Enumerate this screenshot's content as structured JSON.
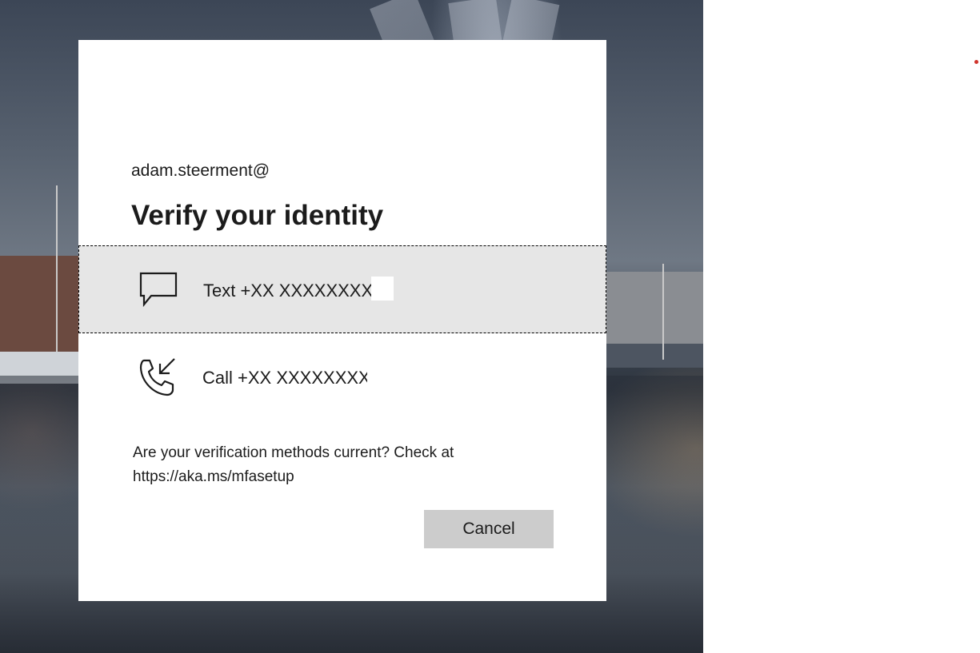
{
  "dialog": {
    "account": "adam.steerment@",
    "title": "Verify your identity",
    "options": [
      {
        "icon": "chat-bubble-icon",
        "label": "Text +XX XXXXXXXXX"
      },
      {
        "icon": "incoming-call-icon",
        "label": "Call +XX XXXXXXXXX"
      }
    ],
    "info_line1": "Are your verification methods current? Check at",
    "info_line2": "https://aka.ms/mfasetup",
    "cancel_label": "Cancel"
  },
  "colors": {
    "selected_option_bg": "#e6e6e6",
    "cancel_button_bg": "#cccccc",
    "text": "#1b1b1b"
  }
}
